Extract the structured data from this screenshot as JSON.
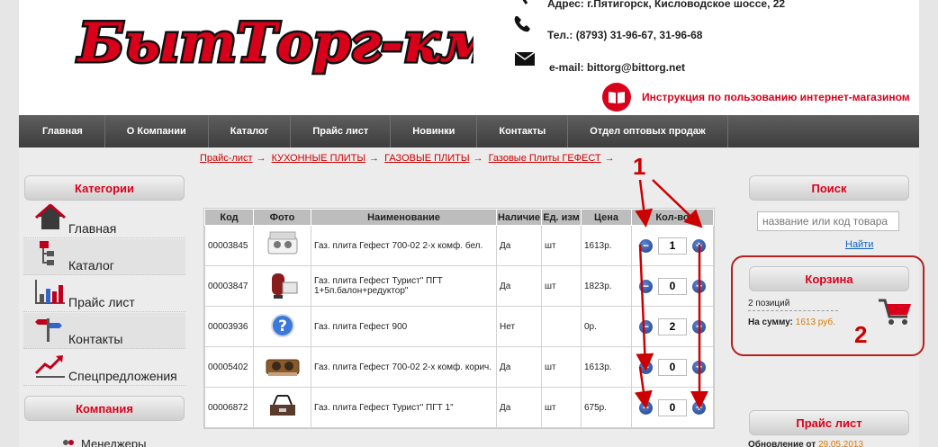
{
  "header": {
    "address": "Адрес: г.Пятигорск, Кисловодское шоссе, 22",
    "phone": "Тел.: (8793) 31-96-67, 31-96-68",
    "email": "e-mail: bittorg@bittorg.net",
    "instructions": "Инструкция по пользованию интернет-магазином",
    "logo_text": "БытТорг-кмв"
  },
  "nav": {
    "items": [
      "Главная",
      "О Компании",
      "Каталог",
      "Прайс лист",
      "Новинки",
      "Контакты",
      "Отдел оптовых продаж"
    ]
  },
  "breadcrumb": {
    "items": [
      "Прайс-лист",
      "КУХОННЫЕ ПЛИТЫ",
      "ГАЗОВЫЕ ПЛИТЫ",
      "Газовые Плиты ГЕФЕСТ"
    ],
    "separator": "→"
  },
  "sidebar": {
    "categories_title": "Категории",
    "items": [
      {
        "label": "Главная",
        "icon": "home-icon"
      },
      {
        "label": "Каталог",
        "icon": "catalog-icon"
      },
      {
        "label": "Прайс лист",
        "icon": "chart-icon"
      },
      {
        "label": "Контакты",
        "icon": "signpost-icon"
      },
      {
        "label": "Спецпредложения",
        "icon": "trend-icon"
      }
    ],
    "company_title": "Компания",
    "company_item_partial": "Менеджеры"
  },
  "table": {
    "headers": [
      "Код",
      "Фото",
      "Наименование",
      "Наличие",
      "Ед. изм",
      "Цена",
      "Кол-во"
    ],
    "rows": [
      {
        "code": "00003845",
        "name": "Газ. плита Гефест 700-02 2-х комф. бел.",
        "avail": "Да",
        "unit": "шт",
        "price": "1613р.",
        "qty": "1",
        "photo": "gas-stove-white"
      },
      {
        "code": "00003847",
        "name": "Газ. плита Гефест Турист\" ПГТ 1+5п.балон+редуктор\"",
        "avail": "Да",
        "unit": "шт",
        "price": "1823р.",
        "qty": "0",
        "photo": "gas-stove-tourist-balloon"
      },
      {
        "code": "00003936",
        "name": "Газ. плита Гефест 900",
        "avail": "Нет",
        "unit": "",
        "price": "0р.",
        "qty": "2",
        "photo": "question-icon"
      },
      {
        "code": "00005402",
        "name": "Газ. плита Гефест 700-02 2-х комф. корич.",
        "avail": "Да",
        "unit": "шт",
        "price": "1613р.",
        "qty": "0",
        "photo": "gas-stove-brown"
      },
      {
        "code": "00006872",
        "name": "Газ. плита Гефест Турист\" ПГТ 1\"",
        "avail": "Да",
        "unit": "шт",
        "price": "675р.",
        "qty": "0",
        "photo": "gas-stove-tourist"
      }
    ],
    "minus": "−",
    "plus": "+"
  },
  "search": {
    "title": "Поиск",
    "placeholder": "название или код товара",
    "button": "Найти"
  },
  "cart": {
    "title": "Корзина",
    "count": "2 позиций",
    "sum_label": "На сумму:",
    "sum_value": "1613 руб."
  },
  "price_list": {
    "title": "Прайс лист",
    "updated_label": "Обновление от",
    "updated_value": "29.05.2013"
  },
  "annotations": {
    "one": "1",
    "two": "2"
  },
  "colors": {
    "accent": "#d9001b",
    "nav": "#4a4a4a",
    "link": "#0f64c8",
    "annotation": "#c00000"
  }
}
